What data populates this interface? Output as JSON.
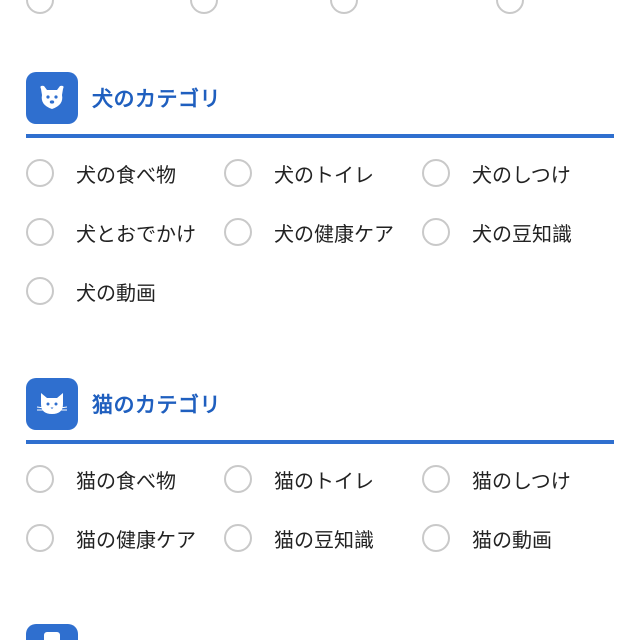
{
  "sections": [
    {
      "icon": "dog-face-icon",
      "title": "犬のカテゴリ",
      "options": [
        "犬の食べ物",
        "犬のトイレ",
        "犬のしつけ",
        "犬とおでかけ",
        "犬の健康ケア",
        "犬の豆知識",
        "犬の動画"
      ]
    },
    {
      "icon": "cat-face-icon",
      "title": "猫のカテゴリ",
      "options": [
        "猫の食べ物",
        "猫のトイレ",
        "猫のしつけ",
        "猫の健康ケア",
        "猫の豆知識",
        "猫の動画"
      ]
    }
  ],
  "colors": {
    "accent": "#2f6fcf",
    "title": "#1f5fbf",
    "radio_border": "#c9c9c9",
    "text": "#222222"
  }
}
